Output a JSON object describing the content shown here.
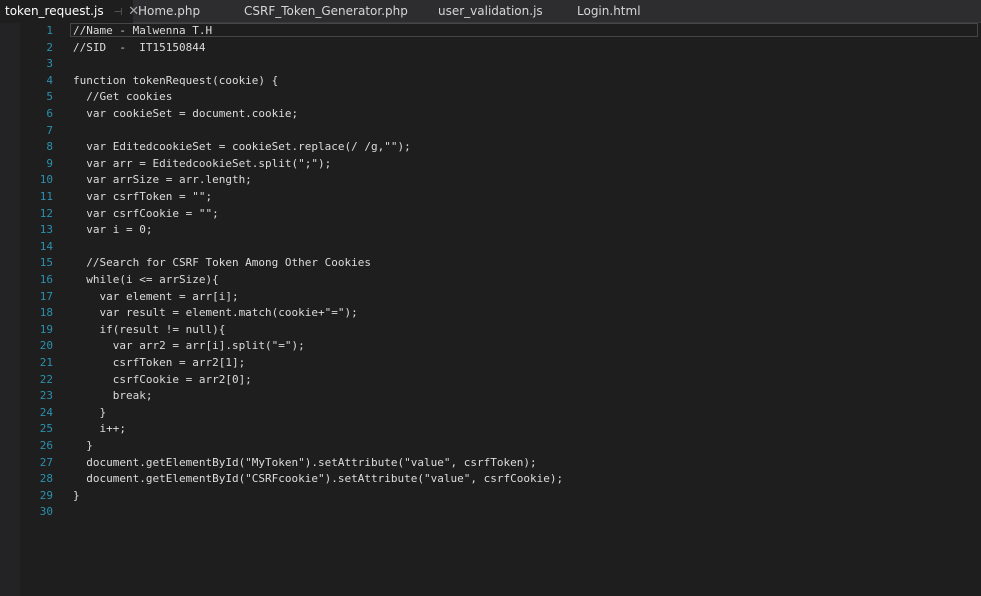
{
  "tabs": [
    {
      "label": "token_request.js",
      "active": true,
      "pin_icon": "pin-icon",
      "close_icon": "close-icon"
    },
    {
      "label": "Home.php"
    },
    {
      "label": "CSRF_Token_Generator.php"
    },
    {
      "label": "user_validation.js"
    },
    {
      "label": "Login.html"
    }
  ],
  "tab_glyphs": {
    "pin": "⊣",
    "close": "✕"
  },
  "colors": {
    "background": "#1e1e1e",
    "tabbar": "#2d2d30",
    "line_numbers": "#2b91af",
    "text": "#dcdcdc"
  },
  "editor": {
    "lines": [
      {
        "n": "1",
        "text": "//Name - Malwenna T.H"
      },
      {
        "n": "2",
        "text": "//SID  -  IT15150844"
      },
      {
        "n": "3",
        "text": ""
      },
      {
        "n": "4",
        "text": "function tokenRequest(cookie) {"
      },
      {
        "n": "5",
        "text": "  //Get cookies"
      },
      {
        "n": "6",
        "text": "  var cookieSet = document.cookie;"
      },
      {
        "n": "7",
        "text": ""
      },
      {
        "n": "8",
        "text": "  var EditedcookieSet = cookieSet.replace(/ /g,\"\");"
      },
      {
        "n": "9",
        "text": "  var arr = EditedcookieSet.split(\";\");"
      },
      {
        "n": "10",
        "text": "  var arrSize = arr.length;"
      },
      {
        "n": "11",
        "text": "  var csrfToken = \"\";"
      },
      {
        "n": "12",
        "text": "  var csrfCookie = \"\";"
      },
      {
        "n": "13",
        "text": "  var i = 0;"
      },
      {
        "n": "14",
        "text": ""
      },
      {
        "n": "15",
        "text": "  //Search for CSRF Token Among Other Cookies"
      },
      {
        "n": "16",
        "text": "  while(i <= arrSize){"
      },
      {
        "n": "17",
        "text": "    var element = arr[i];"
      },
      {
        "n": "18",
        "text": "    var result = element.match(cookie+\"=\");"
      },
      {
        "n": "19",
        "text": "    if(result != null){"
      },
      {
        "n": "20",
        "text": "      var arr2 = arr[i].split(\"=\");"
      },
      {
        "n": "21",
        "text": "      csrfToken = arr2[1];"
      },
      {
        "n": "22",
        "text": "      csrfCookie = arr2[0];"
      },
      {
        "n": "23",
        "text": "      break;"
      },
      {
        "n": "24",
        "text": "    }"
      },
      {
        "n": "25",
        "text": "    i++;"
      },
      {
        "n": "26",
        "text": "  }"
      },
      {
        "n": "27",
        "text": "  document.getElementById(\"MyToken\").setAttribute(\"value\", csrfToken);"
      },
      {
        "n": "28",
        "text": "  document.getElementById(\"CSRFcookie\").setAttribute(\"value\", csrfCookie);"
      },
      {
        "n": "29",
        "text": "}"
      },
      {
        "n": "30",
        "text": ""
      }
    ]
  }
}
